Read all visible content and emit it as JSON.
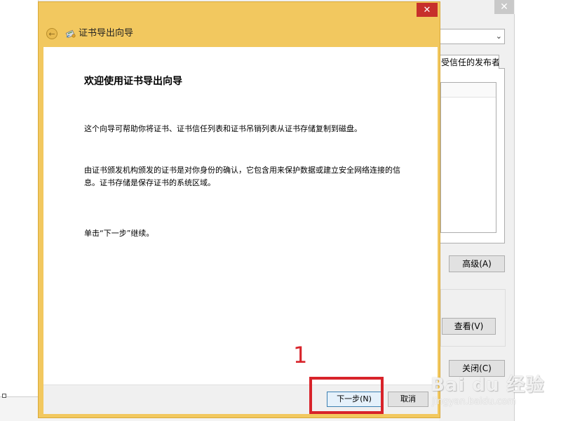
{
  "wizard": {
    "title": "证书导出向导",
    "heading": "欢迎使用证书导出向导",
    "paragraphs": [
      "这个向导可帮助你将证书、证书信任列表和证书吊销列表从证书存储复制到磁盘。",
      "由证书颁发机构颁发的证书是对你身份的确认，它包含用来保护数据或建立安全网络连接的信息。证书存储是保存证书的系统区域。",
      "单击“下一步”继续。"
    ],
    "buttons": {
      "next": "下一步(N)",
      "cancel": "取消"
    },
    "close_glyph": "✕",
    "back_glyph": "←"
  },
  "background_window": {
    "tab_label": "受信任的发布者",
    "buttons": {
      "advanced": "高级(A)",
      "view": "查看(V)",
      "close": "关闭(C)"
    },
    "close_glyph": "✕"
  },
  "annotation": {
    "step_number": "1",
    "color": "#d8232a"
  },
  "watermark": {
    "main": "Bai du 经验",
    "sub": "jingyan.baidu.com"
  },
  "colors": {
    "wizard_frame": "#f2c85f",
    "wizard_close": "#c7302b"
  },
  "icons": {
    "back": "back-arrow-icon",
    "cert": "certificate-icon",
    "close": "close-icon"
  }
}
